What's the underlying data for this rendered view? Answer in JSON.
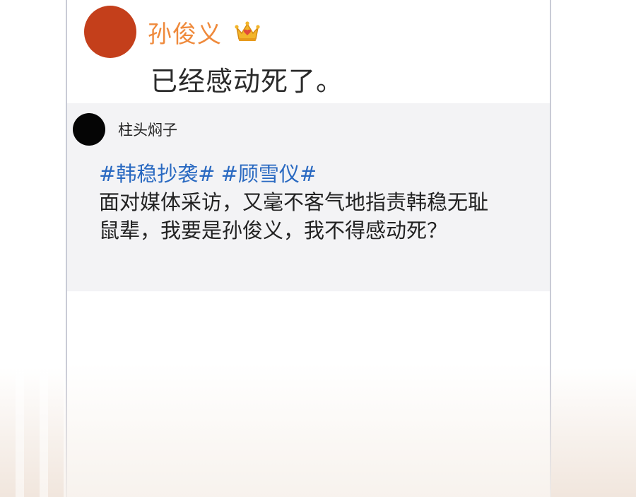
{
  "comment": {
    "author": "孙俊义",
    "text": "已经感动死了。",
    "author_color": "#ef8a3c",
    "avatar_color": "#c43f1b",
    "badge_icon": "crown-icon"
  },
  "quoted_post": {
    "username": "柱头焖子",
    "hashtags": [
      "#韩稳抄袭#",
      "#顾雪仪#"
    ],
    "body_line1": "面对媒体采访，又毫不客气地指责韩稳无耻",
    "body_line2": "鼠辈，我要是孙俊义，我不得感动死？",
    "hashtag_color": "#2969c1"
  }
}
